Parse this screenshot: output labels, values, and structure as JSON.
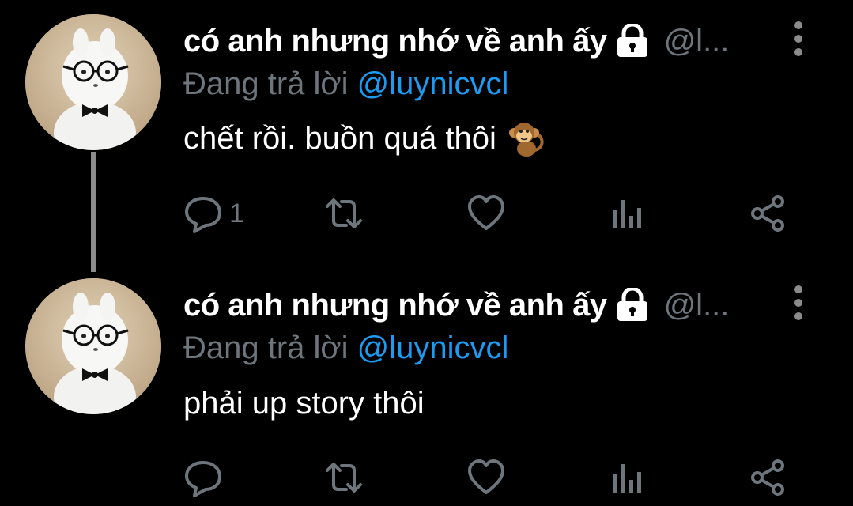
{
  "tweets": [
    {
      "display_name": "có anh nhưng nhớ về anh ấy",
      "handle": "@l...",
      "replying_prefix": "Đang trả lời ",
      "replying_to": "@luynicvcl",
      "text": "chết rồi. buồn quá thôi",
      "emoji": "monkey-emoji",
      "reply_count": "1"
    },
    {
      "display_name": "có anh nhưng nhớ về anh ấy",
      "handle": "@l...",
      "replying_prefix": "Đang trả lời ",
      "replying_to": "@luynicvcl",
      "text": "phải up story thôi",
      "reply_count": ""
    }
  ],
  "icons": {
    "reply": "reply-icon",
    "retweet": "retweet-icon",
    "like": "like-icon",
    "analytics": "analytics-icon",
    "share": "share-icon",
    "lock": "lock-icon",
    "more": "more-vertical-icon"
  },
  "colors": {
    "background": "#000000",
    "text": "#ffffff",
    "secondary": "#6e767d",
    "mention": "#1d9bf0",
    "thread_line": "#8b8b8b"
  }
}
